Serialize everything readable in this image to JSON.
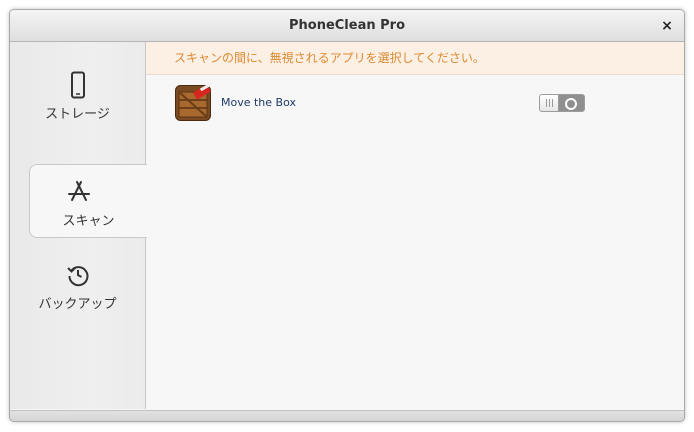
{
  "window": {
    "title": "PhoneClean Pro",
    "close_glyph": "×"
  },
  "sidebar": {
    "items": [
      {
        "label": "ストレージ",
        "icon": "phone-icon",
        "active": false
      },
      {
        "label": "スキャン",
        "icon": "app-store-icon",
        "active": true
      },
      {
        "label": "バックアップ",
        "icon": "history-icon",
        "active": false
      }
    ]
  },
  "main": {
    "notice": "スキャンの間に、無視されるアプリを選択してください。",
    "apps": [
      {
        "name": "Move the Box",
        "icon": "move-the-box-app-icon",
        "toggle_on": false
      }
    ]
  },
  "colors": {
    "notice_text": "#dd8a32",
    "notice_bg": "#fcf0e4",
    "app_name": "#1d3a66"
  }
}
